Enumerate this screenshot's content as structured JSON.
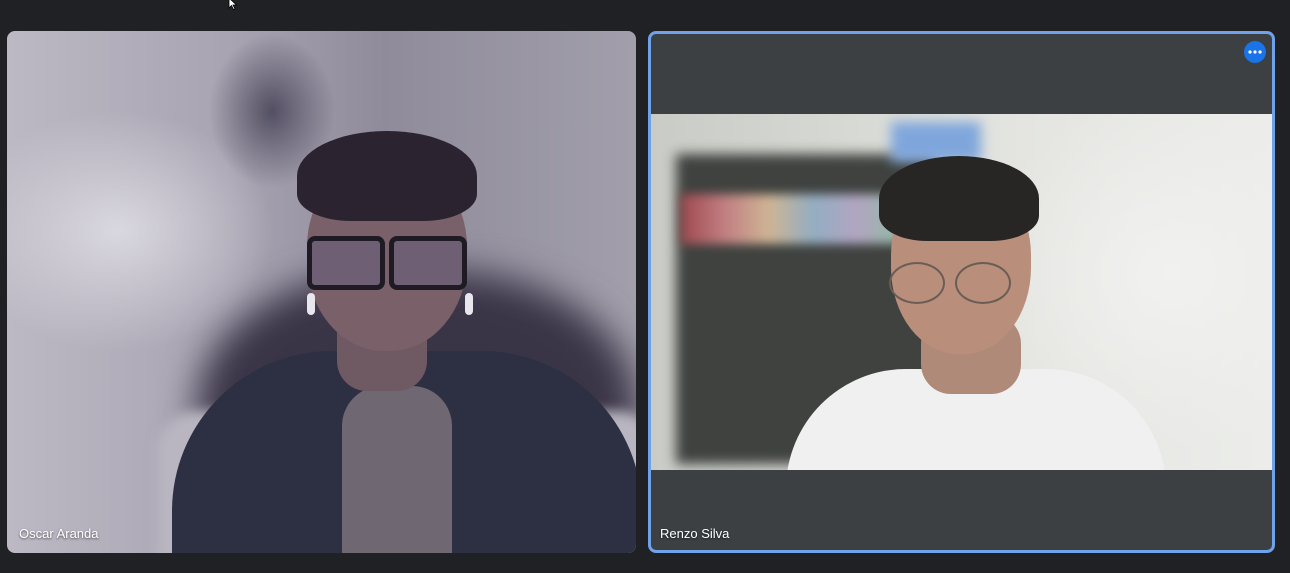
{
  "participants": [
    {
      "name": "Oscar Aranda"
    },
    {
      "name": "Renzo Silva",
      "active_speaker": true,
      "more_options_icon": "more-horizontal-icon"
    }
  ],
  "colors": {
    "background": "#202124",
    "active_border": "#6fa2ea",
    "more_button": "#1a73e8",
    "tile_bg": "#3c4043"
  }
}
